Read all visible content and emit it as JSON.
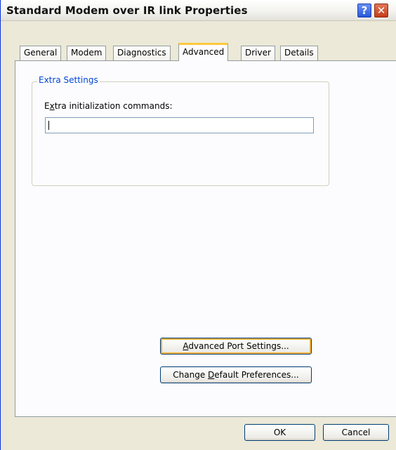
{
  "window": {
    "title": "Standard Modem over IR link Properties",
    "help_glyph": "?",
    "close_glyph": "✕"
  },
  "tabs": [
    {
      "label": "General",
      "active": false
    },
    {
      "label": "Modem",
      "active": false
    },
    {
      "label": "Diagnostics",
      "active": false
    },
    {
      "label": "Advanced",
      "active": true
    },
    {
      "label": "Driver",
      "active": false
    },
    {
      "label": "Details",
      "active": false
    }
  ],
  "extra_settings": {
    "group_title": "Extra Settings",
    "field_label_pre": "E",
    "field_label_accel": "x",
    "field_label_post": "tra initialization commands:",
    "field_value": ""
  },
  "buttons": {
    "advanced_port_pre": "",
    "advanced_port_accel": "A",
    "advanced_port_post": "dvanced Port Settings...",
    "change_defaults_pre": "Change ",
    "change_defaults_accel": "D",
    "change_defaults_post": "efault Preferences...",
    "ok": "OK",
    "cancel": "Cancel"
  },
  "colors": {
    "group_title": "#0046d5",
    "focus_ring": "#f8b33c",
    "active_tab_accent": "#ffc83c"
  }
}
